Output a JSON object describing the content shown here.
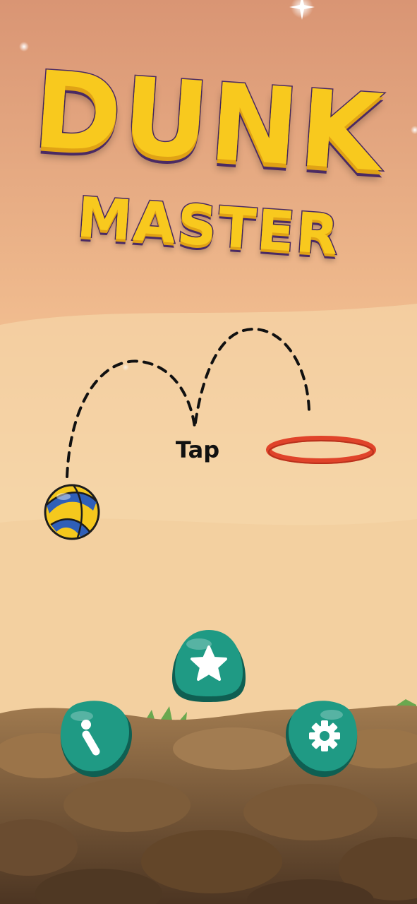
{
  "game": {
    "title_line1": "DUNK",
    "title_line2": "MASTER",
    "tutorial_label": "Tap"
  },
  "buttons": {
    "rate": {
      "icon": "star-icon"
    },
    "info": {
      "icon": "info-icon"
    },
    "settings": {
      "icon": "gear-icon"
    }
  },
  "colors": {
    "sky_top": "#d99574",
    "sand": "#f4d2a4",
    "title_fill": "#f8c91e",
    "title_outline": "#4a2a63",
    "button_fill": "#1f9a84",
    "button_shadow": "#0f5f52",
    "hoop": "#e0432a",
    "ball_yellow": "#f5c81d",
    "ball_blue": "#2f5fb8"
  }
}
